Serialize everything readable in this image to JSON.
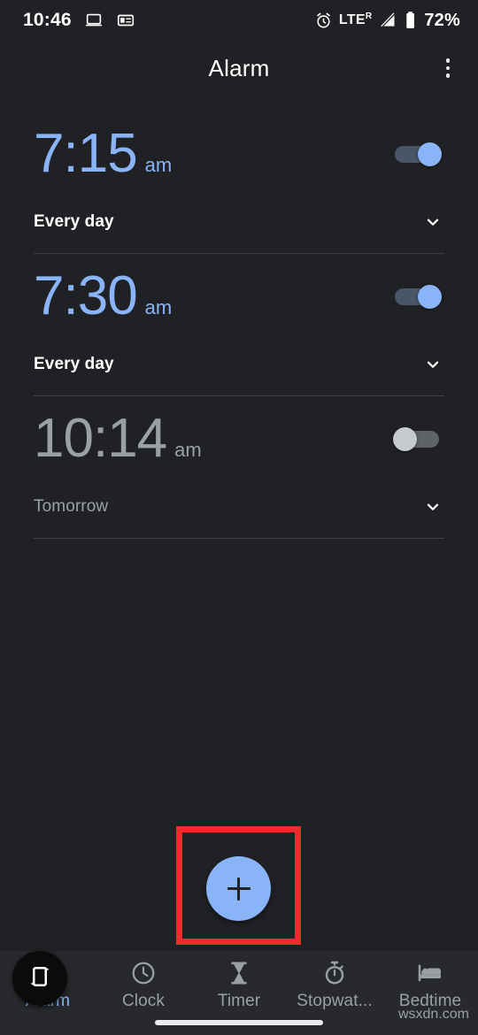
{
  "status_bar": {
    "clock": "10:46",
    "left_icons": [
      "laptop-icon",
      "news-card-icon"
    ],
    "right_icons": [
      "alarm-icon",
      "signal-icon",
      "battery-icon"
    ],
    "network": "LTE",
    "network_superscript": "R",
    "battery_percent": "72%"
  },
  "app_bar": {
    "title": "Alarm",
    "overflow_label": "More options"
  },
  "alarms": [
    {
      "time": "7:15",
      "meridiem": "am",
      "repeat": "Every day",
      "enabled": true,
      "expand_label": "Expand alarm"
    },
    {
      "time": "7:30",
      "meridiem": "am",
      "repeat": "Every day",
      "enabled": true,
      "expand_label": "Expand alarm"
    },
    {
      "time": "10:14",
      "meridiem": "am",
      "repeat": "Tomorrow",
      "enabled": false,
      "expand_label": "Expand alarm"
    }
  ],
  "fab": {
    "label": "+",
    "icon": "plus-icon",
    "highlighted": true,
    "highlight_color": "#ef2b2b",
    "color": "#8ab4f8"
  },
  "bottom_nav": {
    "items": [
      {
        "label": "Alarm",
        "icon": "alarm-clock-icon",
        "active": true
      },
      {
        "label": "Clock",
        "icon": "clock-icon",
        "active": false
      },
      {
        "label": "Timer",
        "icon": "hourglass-icon",
        "active": false
      },
      {
        "label": "Stopwat...",
        "icon": "stopwatch-icon",
        "active": false
      },
      {
        "label": "Bedtime",
        "icon": "bed-icon",
        "active": false
      }
    ]
  },
  "overlay": {
    "rotate_button_icon": "screen-rotate-icon"
  },
  "watermark": "wsxdn.com",
  "colors": {
    "background": "#202124",
    "accent_blue": "#8ab4f8",
    "nav_background": "#28292c",
    "disabled_gray": "#9aa0a6",
    "divider": "#3c4043"
  }
}
